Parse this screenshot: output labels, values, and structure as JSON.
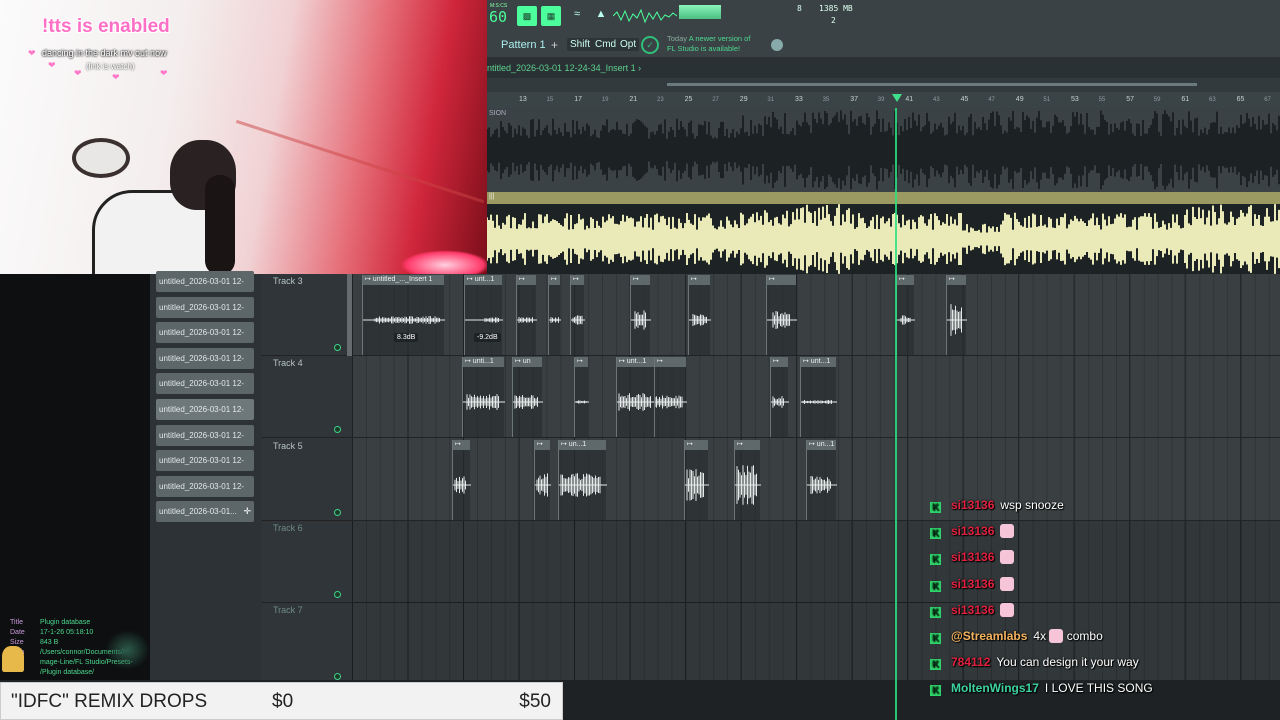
{
  "webcam": {
    "tts_text": "!tts is enabled",
    "now_playing": "dancing in the dark mv out now",
    "now_playing_sub": "(link is watch)"
  },
  "toolbar": {
    "bpm_label": "M:S:CS",
    "bpm": "60",
    "mini_counter": "8",
    "memory": "1385 MB",
    "voices": "2",
    "pattern": "Pattern 1",
    "plus": "+",
    "modes": [
      "Shift",
      "Cmd",
      "Opt"
    ],
    "hint_line1_prefix": "Today",
    "hint_line1": "A newer version of",
    "hint_line2": "FL Studio is available!"
  },
  "playlist": {
    "title": "ntitled_2026-03-01 12-24-34_Insert 1",
    "title_suffix": "›",
    "bars": [
      "13",
      "15",
      "17",
      "19",
      "21",
      "23",
      "25",
      "27",
      "29",
      "31",
      "33",
      "35",
      "37",
      "39",
      "41",
      "43",
      "45",
      "47",
      "49",
      "51",
      "53",
      "55",
      "57",
      "59",
      "61",
      "63",
      "65",
      "67"
    ],
    "wave_top_label": "SION",
    "wave_sep_label": "|||"
  },
  "browser": {
    "files": [
      "untitled_2026-03-01 12-",
      "untitled_2026-03-01 12-",
      "untitled_2026-03-01 12-",
      "untitled_2026-03-01 12-",
      "untitled_2026-03-01 12-",
      "untitled_2026-03-01 12-",
      "untitled_2026-03-01 12-",
      "untitled_2026-03-01 12-",
      "untitled_2026-03-01 12-",
      "untitled_2026-03-01..."
    ],
    "selected_index": 5,
    "info": {
      "title_key": "Title",
      "title_val": "Plugin database",
      "date_key": "Date",
      "date_val": "17-1-26 05:18:10",
      "size_key": "Size",
      "size_val": "843 B",
      "path_key": "Path",
      "path_val1": "/Users/connor/Documents/I-",
      "path_val2": "mage-Line/FL Studio/Presets-",
      "path_val3": "/Plugin database/"
    }
  },
  "tracks": [
    {
      "name": "Track 3",
      "dim": false
    },
    {
      "name": "Track 4",
      "dim": false
    },
    {
      "name": "Track 5",
      "dim": false
    },
    {
      "name": "Track 6",
      "dim": true
    },
    {
      "name": "Track 7",
      "dim": true
    }
  ],
  "clips": {
    "track3": [
      "untitled_..._Insert 1",
      "unt...1",
      "",
      "",
      "",
      "",
      "",
      "",
      ""
    ],
    "track3_db": [
      "8.3dB",
      "-9.2dB"
    ],
    "track4": [
      "unti...1",
      "un",
      "",
      "unt...1",
      "",
      "",
      "",
      "unt...1"
    ],
    "track5": [
      "",
      "",
      "un...1",
      "",
      "",
      "",
      "un...1"
    ]
  },
  "chat": [
    {
      "user": "si13136",
      "color": "#e0213f",
      "text": "wsp snooze",
      "emote": false
    },
    {
      "user": "si13136",
      "color": "#e0213f",
      "text": "",
      "emote": true
    },
    {
      "user": "si13136",
      "color": "#e0213f",
      "text": "",
      "emote": true
    },
    {
      "user": "si13136",
      "color": "#e0213f",
      "text": "",
      "emote": true
    },
    {
      "user": "si13136",
      "color": "#e0213f",
      "text": "",
      "emote": true
    },
    {
      "user": "@Streamlabs",
      "color": "#f5b35f",
      "text": "4x",
      "emote": true,
      "suffix": "combo"
    },
    {
      "user": "784112",
      "color": "#e0213f",
      "text": "You can design it your way",
      "emote": false
    },
    {
      "user": "MoltenWings17",
      "color": "#3fd3a0",
      "text": "I LOVE THIS SONG",
      "emote": false
    }
  ],
  "chat_badge": "K",
  "goal": {
    "title": "\"IDFC\" REMIX DROPS",
    "current": "$0",
    "target": "$50",
    "progress_fraction": 0
  },
  "colors": {
    "accent_green": "#4dff9c",
    "playhead": "#2ee07f",
    "waveform_bright": "#e9eab8",
    "tts_pink": "#ff6fc6"
  }
}
